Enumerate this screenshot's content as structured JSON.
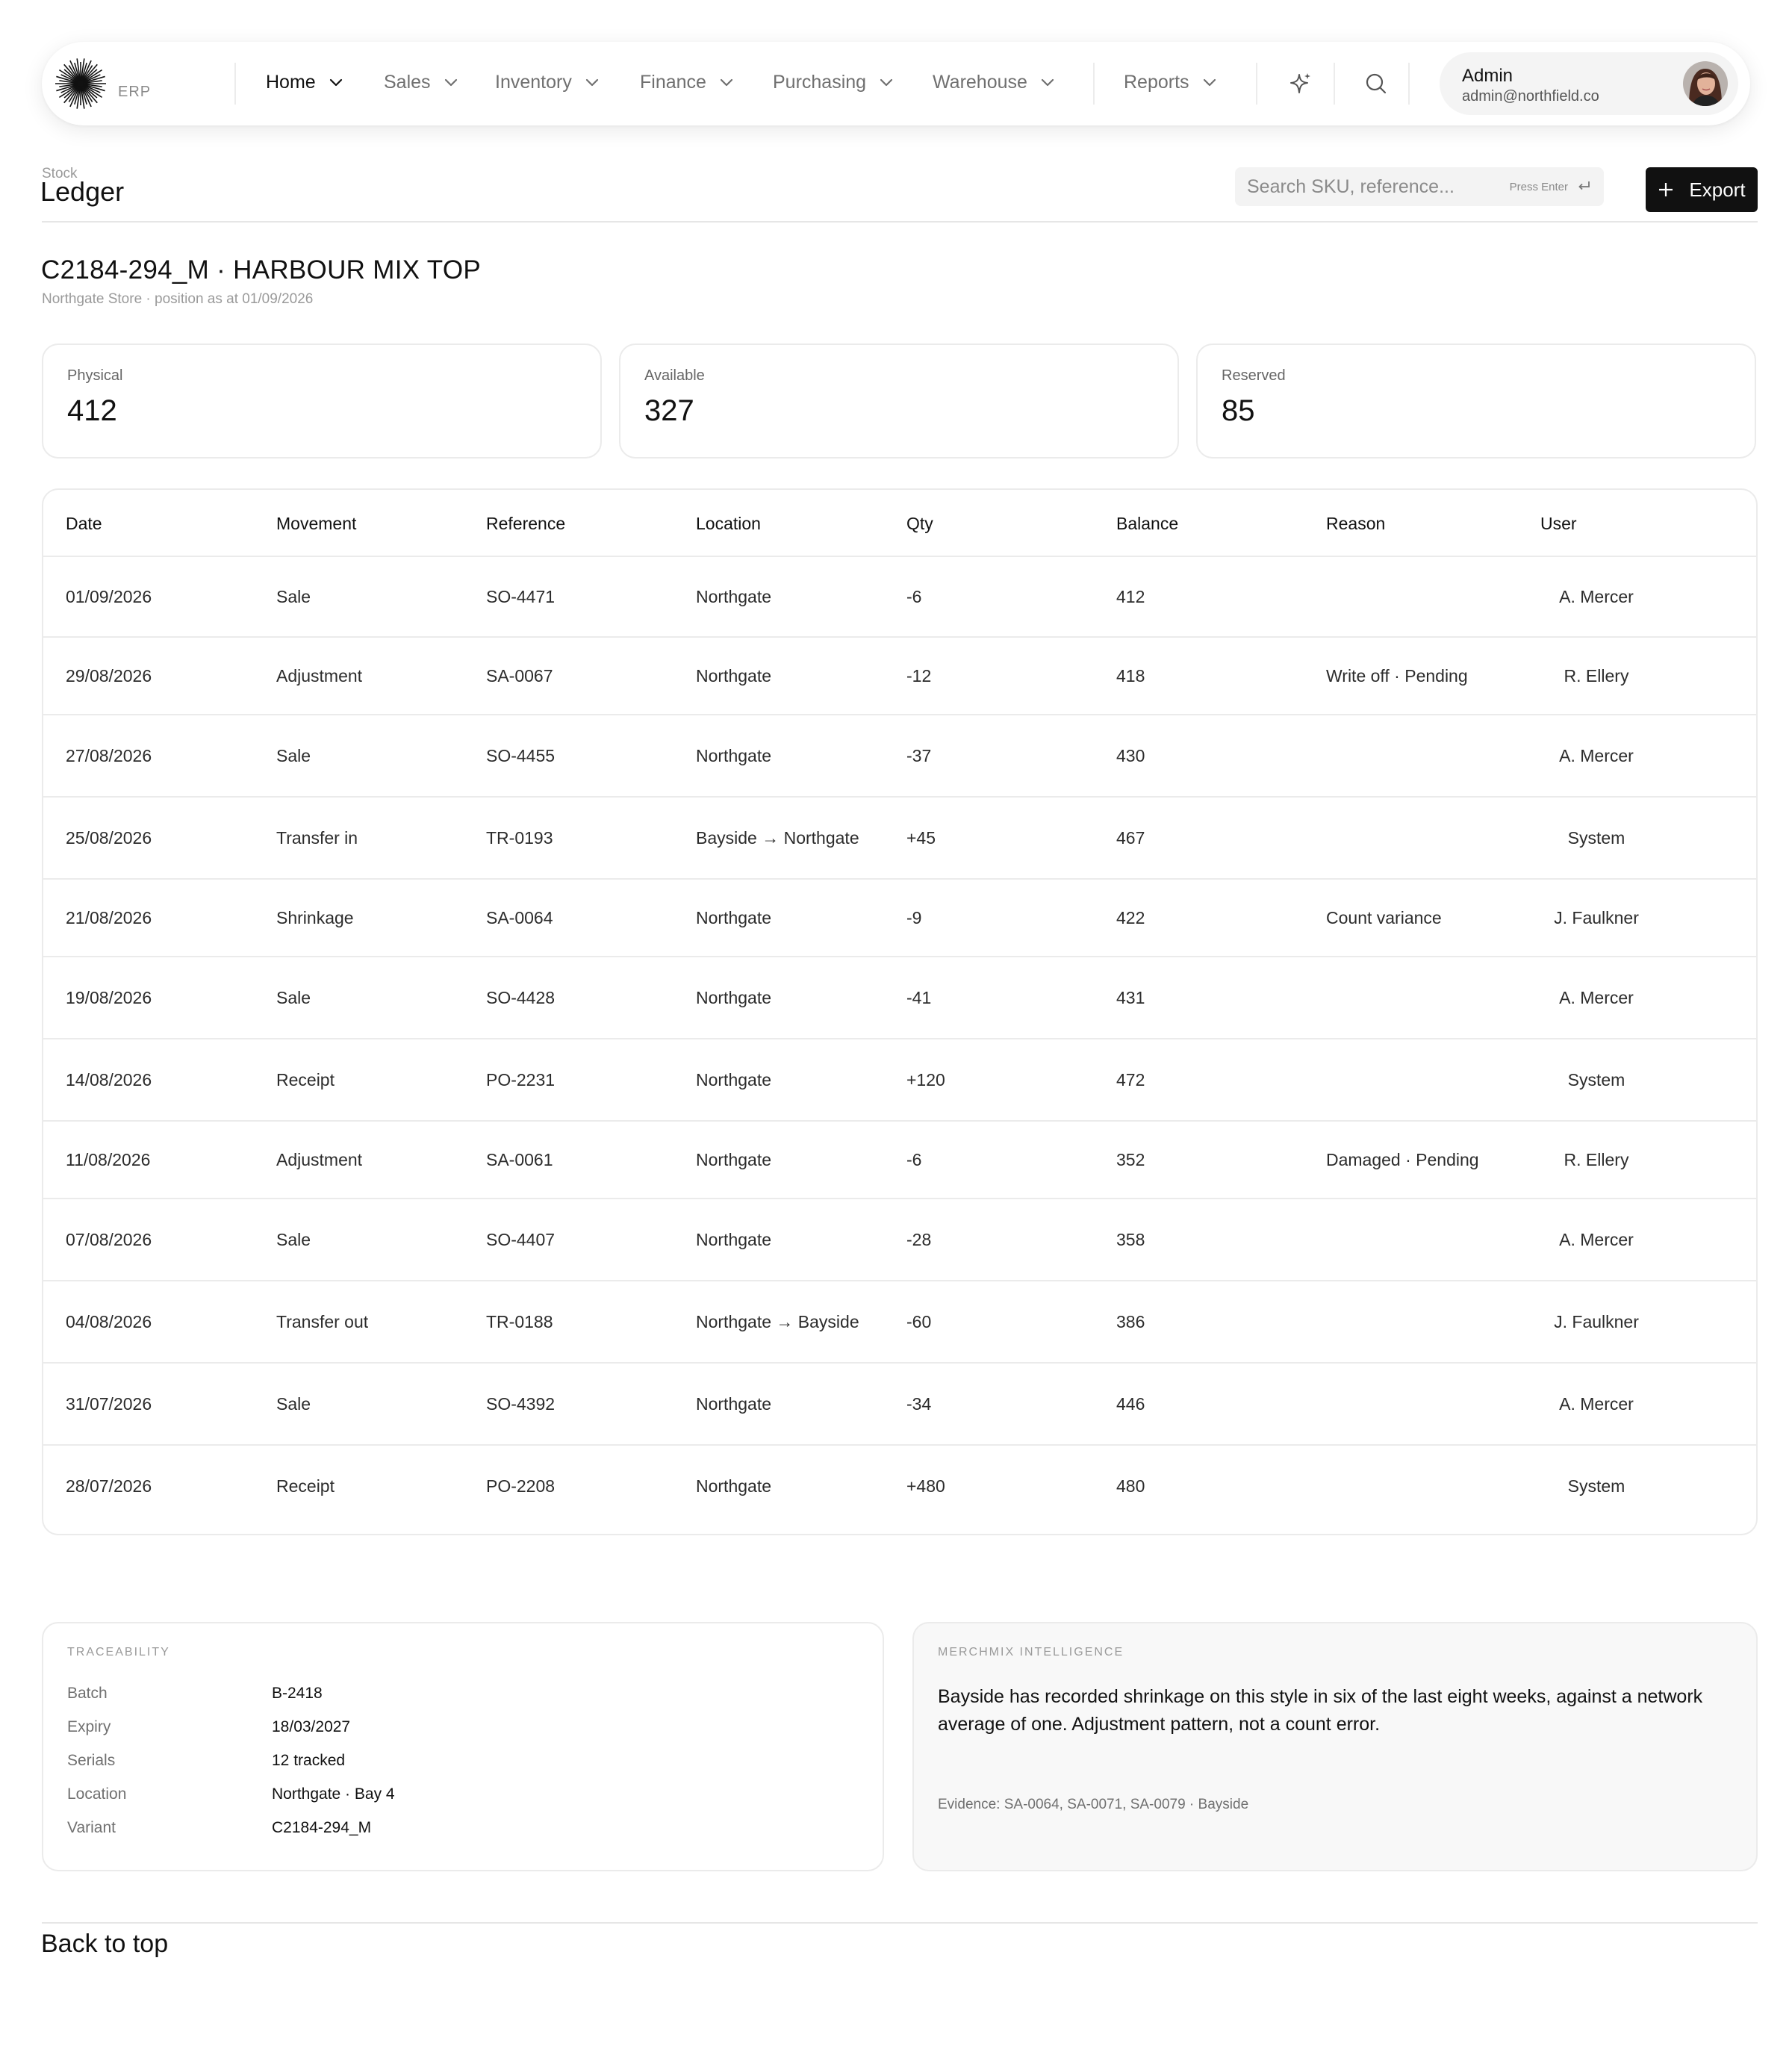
{
  "nav": {
    "logo_text": "ERP",
    "items": [
      {
        "label": "Home"
      },
      {
        "label": "Sales"
      },
      {
        "label": "Inventory"
      },
      {
        "label": "Finance"
      },
      {
        "label": "Purchasing"
      },
      {
        "label": "Warehouse"
      },
      {
        "label": "Reports"
      }
    ],
    "icons": [
      "sparkle-icon",
      "search-icon"
    ],
    "account": {
      "name": "Admin",
      "email": "admin@northfield.co"
    }
  },
  "header": {
    "eyebrow": "Stock",
    "title": "Ledger",
    "search_placeholder": "Search SKU, reference...",
    "search_hint": "Press Enter",
    "export_label": "Export"
  },
  "item": {
    "title": "C2184-294_M · HARBOUR MIX TOP",
    "subtitle": "Northgate Store · position as at 01/09/2026"
  },
  "stats": [
    {
      "label": "Physical",
      "value": "412"
    },
    {
      "label": "Available",
      "value": "327"
    },
    {
      "label": "Reserved",
      "value": "85"
    }
  ],
  "ledger": {
    "columns": [
      "Date",
      "Movement",
      "Reference",
      "Location",
      "Qty",
      "Balance",
      "Reason",
      "User"
    ],
    "rows": [
      [
        "01/09/2026",
        "Sale",
        "SO-4471",
        "Northgate",
        "-6",
        "412",
        "",
        "A. Mercer"
      ],
      [
        "29/08/2026",
        "Adjustment",
        "SA-0067",
        "Northgate",
        "-12",
        "418",
        "Write off · Pending",
        "R. Ellery"
      ],
      [
        "27/08/2026",
        "Sale",
        "SO-4455",
        "Northgate",
        "-37",
        "430",
        "",
        "A. Mercer"
      ],
      [
        "25/08/2026",
        "Transfer in",
        "TR-0193",
        "Bayside → Northgate",
        "+45",
        "467",
        "",
        "System"
      ],
      [
        "21/08/2026",
        "Shrinkage",
        "SA-0064",
        "Northgate",
        "-9",
        "422",
        "Count variance",
        "J. Faulkner"
      ],
      [
        "19/08/2026",
        "Sale",
        "SO-4428",
        "Northgate",
        "-41",
        "431",
        "",
        "A. Mercer"
      ],
      [
        "14/08/2026",
        "Receipt",
        "PO-2231",
        "Northgate",
        "+120",
        "472",
        "",
        "System"
      ],
      [
        "11/08/2026",
        "Adjustment",
        "SA-0061",
        "Northgate",
        "-6",
        "352",
        "Damaged · Pending",
        "R. Ellery"
      ],
      [
        "07/08/2026",
        "Sale",
        "SO-4407",
        "Northgate",
        "-28",
        "358",
        "",
        "A. Mercer"
      ],
      [
        "04/08/2026",
        "Transfer out",
        "TR-0188",
        "Northgate → Bayside",
        "-60",
        "386",
        "",
        "J. Faulkner"
      ],
      [
        "31/07/2026",
        "Sale",
        "SO-4392",
        "Northgate",
        "-34",
        "446",
        "",
        "A. Mercer"
      ],
      [
        "28/07/2026",
        "Receipt",
        "PO-2208",
        "Northgate",
        "+480",
        "480",
        "",
        "System"
      ]
    ]
  },
  "traceability": {
    "eyebrow": "TRACEABILITY",
    "fields": [
      {
        "key": "Batch",
        "value": "B-2418"
      },
      {
        "key": "Expiry",
        "value": "18/03/2027"
      },
      {
        "key": "Serials",
        "value": "12 tracked"
      },
      {
        "key": "Location",
        "value": "Northgate · Bay 4"
      },
      {
        "key": "Variant",
        "value": "C2184-294_M"
      }
    ]
  },
  "intelligence": {
    "eyebrow": "MERCHMIX INTELLIGENCE",
    "text": "Bayside has recorded shrinkage on this style in six of the last eight weeks, against a network average of one. Adjustment pattern, not a count error.",
    "evidence": "Evidence: SA-0064, SA-0071, SA-0079 · Bayside"
  },
  "footer": {
    "back_to_top": "Back to top"
  },
  "colors": {
    "accent": "#111111",
    "border": "#ebebeb",
    "muted": "#9a9a9a",
    "panel_bg": "#f8f8f8"
  }
}
